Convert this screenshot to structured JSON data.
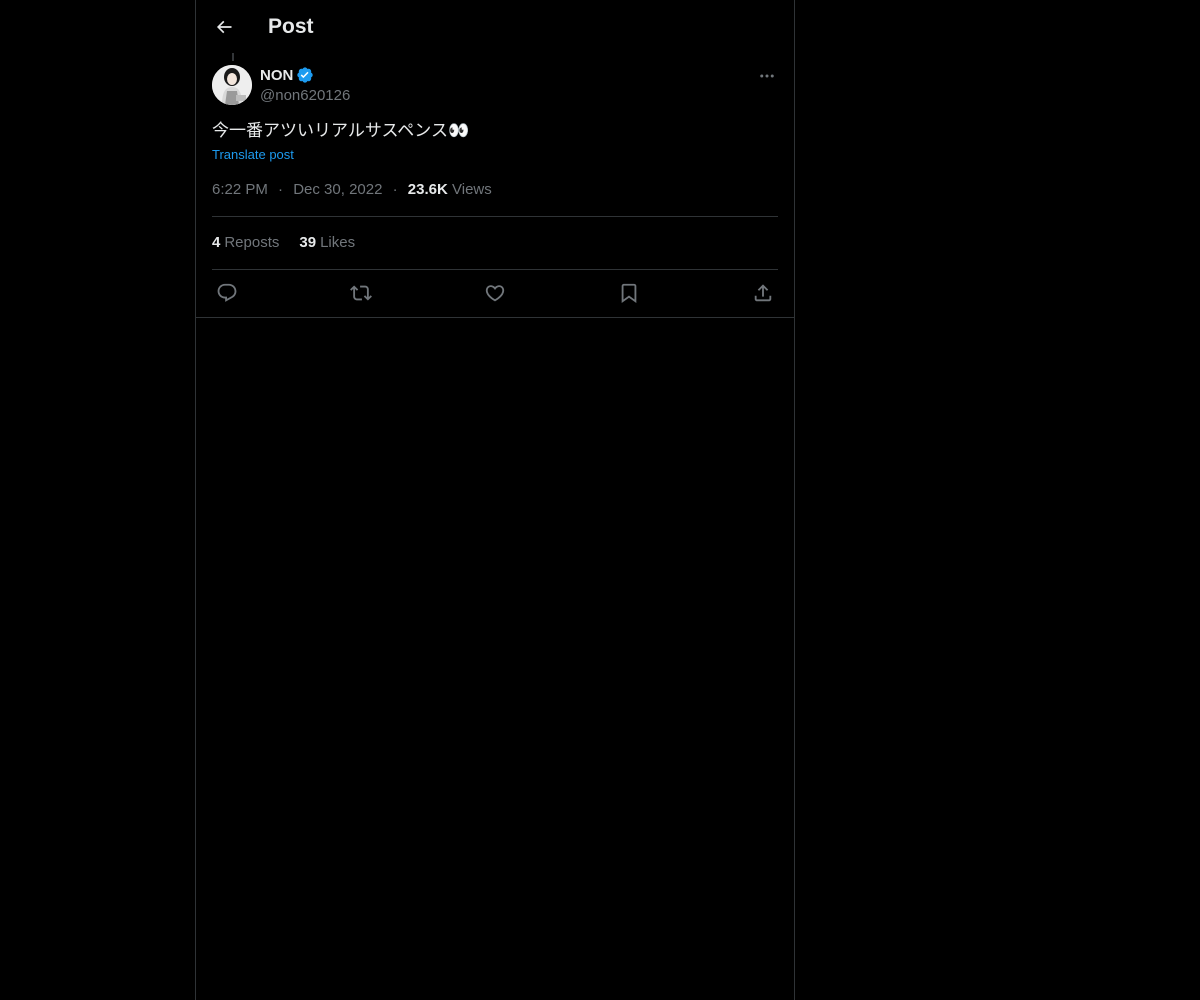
{
  "header": {
    "title": "Post"
  },
  "post": {
    "author": {
      "display_name": "NON",
      "handle": "@non620126",
      "verified": true
    },
    "text": "今一番アツいリアルサスペンス👀",
    "translate_label": "Translate post",
    "time": "6:22 PM",
    "date": "Dec 30, 2022",
    "views_count": "23.6K",
    "views_label": "Views",
    "separator": "·",
    "stats": {
      "reposts_count": "4",
      "reposts_label": "Reposts",
      "likes_count": "39",
      "likes_label": "Likes"
    }
  },
  "colors": {
    "background": "#000000",
    "text_primary": "#e7e9ea",
    "text_secondary": "#71767b",
    "accent": "#1d9bf0",
    "border": "#2f3336"
  },
  "icons": {
    "back": "arrow-left-icon",
    "verified": "verified-badge-icon",
    "more": "more-dots-icon",
    "reply": "reply-icon",
    "repost": "repost-icon",
    "like": "heart-icon",
    "bookmark": "bookmark-icon",
    "share": "share-icon"
  }
}
